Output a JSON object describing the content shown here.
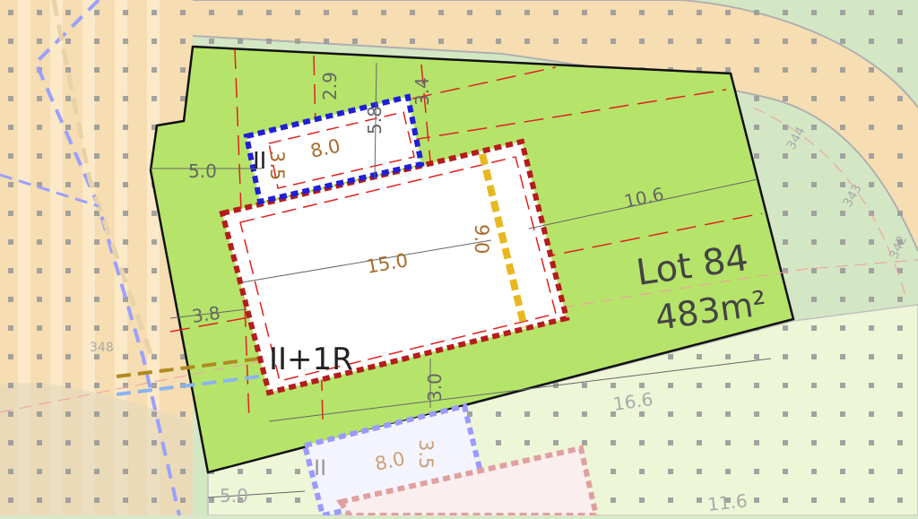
{
  "lot": {
    "name": "Lot 84",
    "area": "483m²"
  },
  "building_labels": {
    "main": "II+1R",
    "annex": "II",
    "neighbor_annex": "II"
  },
  "dimensions": {
    "front_setback_top": "2.9",
    "side_top_right": "3.4",
    "annex_depth": "5.8",
    "annex_width": "8.0",
    "annex_height": "3.5",
    "left_setback": "5.0",
    "main_length": "15.0",
    "main_depth": "9.0",
    "right_distance": "10.6",
    "left_lower": "3.8",
    "rear_gap": "3.0",
    "lot_bottom_width": "16.6",
    "neighbor_annex_width": "8.0",
    "neighbor_annex_height": "3.5",
    "neighbor_left": "5.0",
    "neighbor_right": "11.6"
  },
  "contours": [
    "344",
    "343",
    "342",
    "348"
  ],
  "colors": {
    "lot_fill": "#b6e46a",
    "road_fill": "#f7dcb0",
    "green_area": "#d2e6c2",
    "neighbor_fill": "#eef6d8",
    "main_outline": "#b51c1c",
    "annex_outline": "#1f1fd6",
    "dimension_text": "#a86a2a",
    "setback_line": "#e02020",
    "height_line": "#e8b820"
  }
}
